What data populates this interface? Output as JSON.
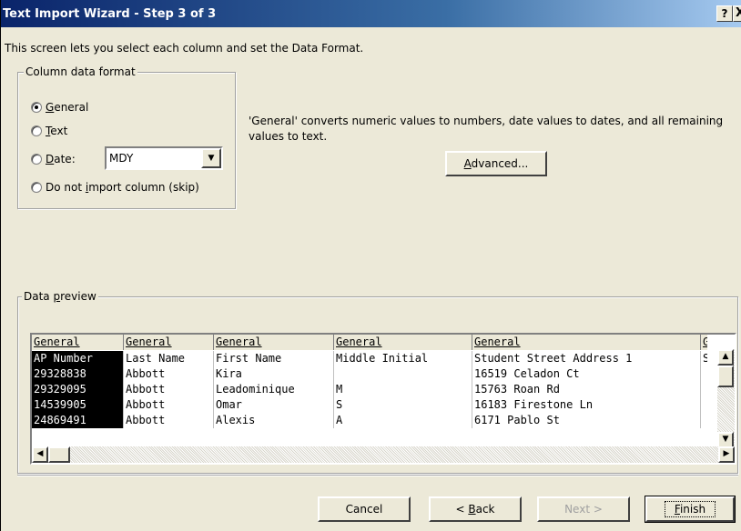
{
  "window": {
    "title": "Text Import Wizard - Step 3 of 3",
    "help_glyph": "?",
    "close_glyph": "X"
  },
  "intro": "This screen lets you select each column and set the Data Format.",
  "column_format": {
    "legend": "Column data format",
    "options": {
      "general": {
        "label_pre": "",
        "label_key": "G",
        "label_post": "eneral",
        "checked": true
      },
      "text": {
        "label_pre": "",
        "label_key": "T",
        "label_post": "ext",
        "checked": false
      },
      "date": {
        "label_pre": "",
        "label_key": "D",
        "label_post": "ate:",
        "checked": false
      },
      "skip": {
        "label_pre": "Do not ",
        "label_key": "i",
        "label_post": "mport column (skip)",
        "checked": false
      }
    },
    "date_format": "MDY"
  },
  "description": "'General' converts numeric values to numbers, date values to dates, and all remaining values to text.",
  "advanced": {
    "label_key": "A",
    "label_post": "dvanced..."
  },
  "data_preview": {
    "legend_pre": "Data ",
    "legend_key": "p",
    "legend_post": "review",
    "columns": [
      "General",
      "General",
      "General",
      "General",
      "General",
      "G"
    ],
    "rows": [
      [
        "AP Number",
        "Last Name",
        "First Name",
        "Middle Initial",
        "Student Street Address 1",
        "S"
      ],
      [
        "29328838",
        "Abbott",
        "Kira",
        "",
        "16519 Celadon Ct",
        ""
      ],
      [
        "29329095",
        "Abbott",
        "Leadominique",
        "M",
        "15763 Roan Rd",
        ""
      ],
      [
        "14539905",
        "Abbott",
        "Omar",
        "S",
        "16183 Firestone Ln",
        ""
      ],
      [
        "24869491",
        "Abbott",
        "Alexis",
        "A",
        "6171 Pablo St",
        ""
      ]
    ]
  },
  "buttons": {
    "cancel": "Cancel",
    "back": {
      "pre": "< ",
      "key": "B",
      "post": "ack"
    },
    "next": "Next >",
    "finish": {
      "key": "F",
      "post": "inish"
    }
  }
}
